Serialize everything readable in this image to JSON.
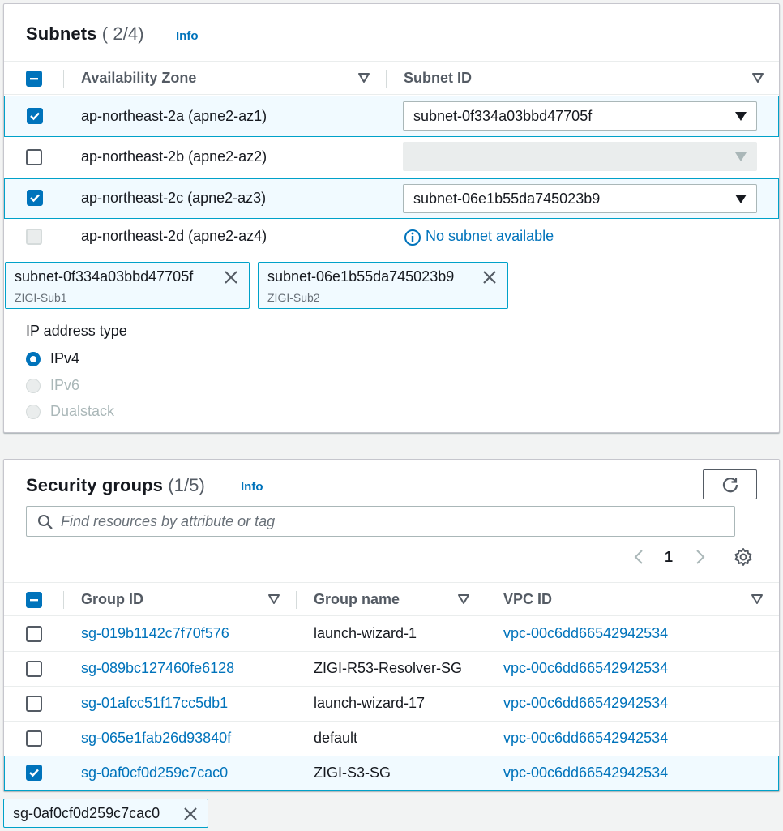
{
  "subnets": {
    "title": "Subnets",
    "count": "( 2/4)",
    "info": "Info",
    "columns": [
      "Availability Zone",
      "Subnet ID"
    ],
    "rows": [
      {
        "az": "ap-northeast-2a (apne2-az1)",
        "subnet": "subnet-0f334a03bbd47705f",
        "state": "checked"
      },
      {
        "az": "ap-northeast-2b (apne2-az2)",
        "subnet": "",
        "state": "unchecked"
      },
      {
        "az": "ap-northeast-2c (apne2-az3)",
        "subnet": "subnet-06e1b55da745023b9",
        "state": "checked"
      },
      {
        "az": "ap-northeast-2d (apne2-az4)",
        "subnet": "No subnet available",
        "state": "disabled"
      }
    ],
    "tokens": [
      {
        "id": "subnet-0f334a03bbd47705f",
        "name": "ZIGI-Sub1"
      },
      {
        "id": "subnet-06e1b55da745023b9",
        "name": "ZIGI-Sub2"
      }
    ]
  },
  "ip_type": {
    "label": "IP address type",
    "options": [
      {
        "label": "IPv4",
        "selected": true,
        "disabled": false
      },
      {
        "label": "IPv6",
        "selected": false,
        "disabled": true
      },
      {
        "label": "Dualstack",
        "selected": false,
        "disabled": true
      }
    ]
  },
  "security_groups": {
    "title": "Security groups",
    "count": "(1/5)",
    "info": "Info",
    "search_placeholder": "Find resources by attribute or tag",
    "page": "1",
    "columns": [
      "Group ID",
      "Group name",
      "VPC ID"
    ],
    "rows": [
      {
        "id": "sg-019b1142c7f70f576",
        "name": "launch-wizard-1",
        "vpc": "vpc-00c6dd66542942534",
        "checked": false
      },
      {
        "id": "sg-089bc127460fe6128",
        "name": "ZIGI-R53-Resolver-SG",
        "vpc": "vpc-00c6dd66542942534",
        "checked": false
      },
      {
        "id": "sg-01afcc51f17cc5db1",
        "name": "launch-wizard-17",
        "vpc": "vpc-00c6dd66542942534",
        "checked": false
      },
      {
        "id": "sg-065e1fab26d93840f",
        "name": "default",
        "vpc": "vpc-00c6dd66542942534",
        "checked": false
      },
      {
        "id": "sg-0af0cf0d259c7cac0",
        "name": "ZIGI-S3-SG",
        "vpc": "vpc-00c6dd66542942534",
        "checked": true
      }
    ],
    "token": "sg-0af0cf0d259c7cac0"
  },
  "colors": {
    "accent": "#0073bb",
    "selected_bg": "#f1faff",
    "selected_border": "#00a1c9"
  }
}
